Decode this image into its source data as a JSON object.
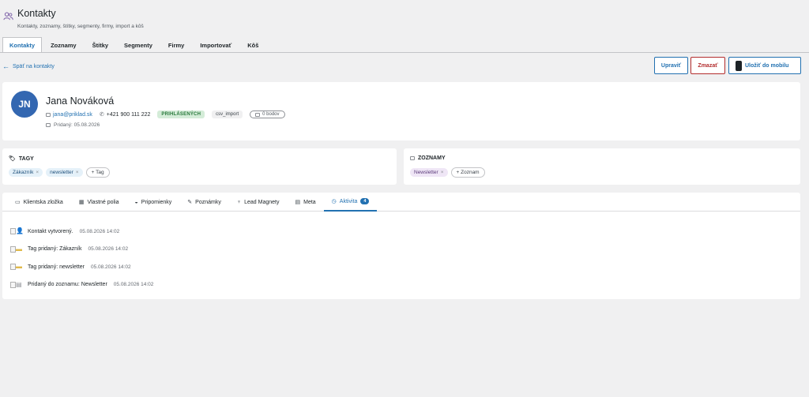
{
  "header": {
    "title": "Kontakty",
    "subtitle": "Kontakty, zoznamy, štítky, segmenty, firmy, import a kôš"
  },
  "tabs": [
    {
      "label": "Kontakty",
      "active": true
    },
    {
      "label": "Zoznamy"
    },
    {
      "label": "Štítky"
    },
    {
      "label": "Segmenty"
    },
    {
      "label": "Firmy"
    },
    {
      "label": "Importovať"
    },
    {
      "label": "Kôš"
    }
  ],
  "back_link": "Späť na kontakty",
  "actions": {
    "edit": "Upraviť",
    "delete": "Zmazať",
    "save_mobile": "Uložiť do mobilu"
  },
  "contact": {
    "initials": "JN",
    "name": "Jana Nováková",
    "email": "jana@priklad.sk",
    "phone": "+421 900 111 222",
    "status": "PRIHLÁSENÝCH",
    "source": "csv_import",
    "points": "0 bodov",
    "added": "Pridaný: 05.08.2026"
  },
  "tags_card": {
    "title": "TAGY",
    "tags": [
      "Zákazník",
      "newsletter"
    ],
    "add_label": "+ Tag"
  },
  "lists_card": {
    "title": "ZOZNAMY",
    "lists": [
      "Newsletter"
    ],
    "add_label": "+ Zoznam"
  },
  "subtabs": [
    {
      "label": "Klientska zložka",
      "icon": "folder-icon"
    },
    {
      "label": "Vlastné polia",
      "icon": "fields-icon"
    },
    {
      "label": "Pripomienky",
      "icon": "bell-icon"
    },
    {
      "label": "Poznámky",
      "icon": "pencil-icon"
    },
    {
      "label": "Lead Magnety",
      "icon": "trophy-icon"
    },
    {
      "label": "Meta",
      "icon": "grid-icon"
    },
    {
      "label": "Aktivita",
      "icon": "clock-icon",
      "count": "4",
      "active": true
    }
  ],
  "activity": [
    {
      "text": "Kontakt vytvorený.",
      "time": "05.08.2026 14:02",
      "icon": "person-icon"
    },
    {
      "text": "Tag pridaný: Zákazník",
      "time": "05.08.2026 14:02",
      "icon": "tag-icon"
    },
    {
      "text": "Tag pridaný: newsletter",
      "time": "05.08.2026 14:02",
      "icon": "tag-icon"
    },
    {
      "text": "Pridaný do zoznamu: Newsletter",
      "time": "05.08.2026 14:02",
      "icon": "list-icon"
    }
  ],
  "colors": {
    "accent": "#2271b1",
    "danger": "#b32d2e",
    "avatar": "#3367b1",
    "status_bg": "#d4ecd8"
  }
}
